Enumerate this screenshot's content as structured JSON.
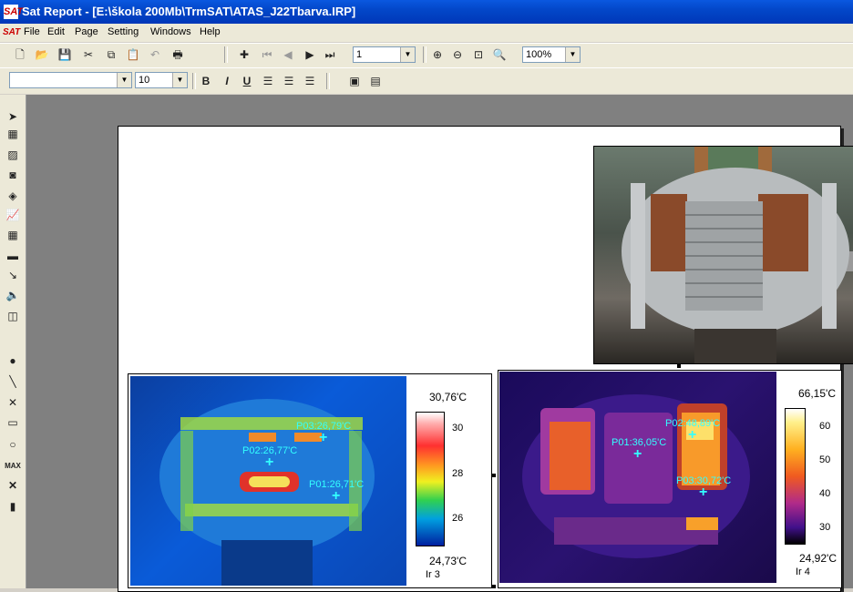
{
  "window": {
    "title": "Sat Report - [E:\\škola 200Mb\\TrmSAT\\ATAS_J22Tbarva.IRP]"
  },
  "menu": [
    "File",
    "Edit",
    "Page",
    "Setting",
    "Windows",
    "Help"
  ],
  "toolbar": {
    "page_number": "1",
    "zoom": "100%"
  },
  "format_toolbar": {
    "font": "",
    "size": "10",
    "bold": "B",
    "italic": "I",
    "underline": "U"
  },
  "ir3": {
    "max": "30,76'C",
    "min": "24,73'C",
    "name": "Ir 3",
    "ticks": [
      "30",
      "28",
      "26"
    ],
    "points": [
      {
        "label": "P03:26,79'C"
      },
      {
        "label": "P02:26,77'C"
      },
      {
        "label": "P01:26,71'C"
      }
    ]
  },
  "ir4": {
    "max": "66,15'C",
    "min": "24,92'C",
    "name": "Ir 4",
    "ticks": [
      "60",
      "50",
      "40",
      "30"
    ],
    "points": [
      {
        "label": "P01:36,05'C"
      },
      {
        "label": "P02:48,89'C"
      },
      {
        "label": "P03:30,72'C"
      }
    ]
  },
  "colors": {
    "titlebar": "#0347c9",
    "marker": "#33ffff",
    "page": "#ffffff",
    "workspace": "#808080"
  }
}
